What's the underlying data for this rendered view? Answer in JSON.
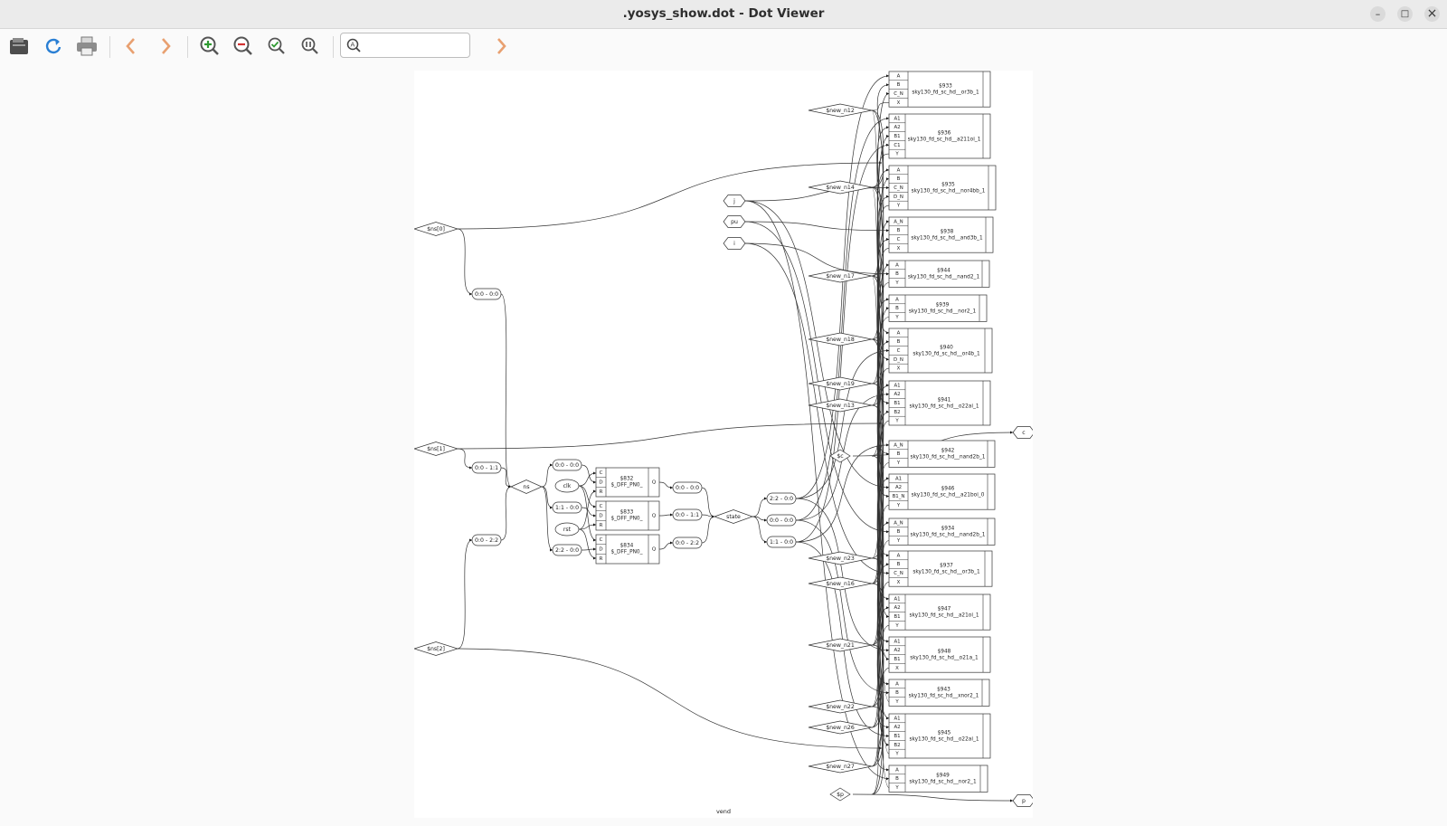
{
  "window": {
    "title": ".yosys_show.dot - Dot Viewer",
    "minimize_glyph": "–",
    "maximize_glyph": "□",
    "close_glyph": "×"
  },
  "toolbar": {
    "buttons": [
      {
        "name": "open-file-button",
        "icon": "folder-icon"
      },
      {
        "name": "reload-button",
        "icon": "reload-icon"
      },
      {
        "name": "print-button",
        "icon": "printer-icon"
      },
      {
        "name": "back-button",
        "icon": "chevron-left-icon"
      },
      {
        "name": "forward-button",
        "icon": "chevron-right-icon"
      },
      {
        "name": "zoom-in-button",
        "icon": "zoom-in-icon"
      },
      {
        "name": "zoom-out-button",
        "icon": "zoom-out-icon"
      },
      {
        "name": "zoom-fit-button",
        "icon": "zoom-fit-icon"
      },
      {
        "name": "zoom-100-button",
        "icon": "zoom-100-icon"
      },
      {
        "name": "find-next-button",
        "icon": "chevron-right-icon"
      }
    ],
    "search": {
      "value": "",
      "placeholder": ""
    }
  },
  "graph": {
    "label": "vend",
    "left_ports": [
      {
        "label": "$ns[0]"
      },
      {
        "label": "$ns[1]"
      },
      {
        "label": "$ns[2]"
      }
    ],
    "split_nodes": [
      {
        "label": "0:0 - 0:0"
      },
      {
        "label": "0:0 - 1:1"
      },
      {
        "label": "0:0 - 2:2"
      }
    ],
    "ns_node": "ns",
    "clk_node": "clk",
    "rst_node": "rst",
    "ns_slices": [
      "0:0 - 0:0",
      "1:1 - 0:0",
      "2:2 - 0:0"
    ],
    "dff_cells": [
      {
        "id": "$832",
        "type": "$_DFF_PN0_",
        "ports": [
          "C",
          "D",
          "R"
        ],
        "out": "Q"
      },
      {
        "id": "$833",
        "type": "$_DFF_PN0_",
        "ports": [
          "C",
          "D",
          "R"
        ],
        "out": "Q"
      },
      {
        "id": "$834",
        "type": "$_DFF_PN0_",
        "ports": [
          "C",
          "D",
          "R"
        ],
        "out": "Q"
      }
    ],
    "q_slices": [
      "0:0 - 0:0",
      "0:0 - 1:1",
      "0:0 - 2:2"
    ],
    "state_node": "state",
    "state_slices": [
      "2:2 - 0:0",
      "0:0 - 0:0",
      "1:1 - 0:0"
    ],
    "inputs": [
      "j",
      "pu",
      "i"
    ],
    "internal_wires": [
      "$new_n12",
      "$new_n14",
      "$new_n17",
      "$new_n18",
      "$new_n19",
      "$new_n13",
      "$c",
      "$new_n23",
      "$new_n16",
      "$new_n21",
      "$new_n22",
      "$new_n26",
      "$new_n27",
      "$p"
    ],
    "outputs": [
      "c",
      "p"
    ],
    "cells": [
      {
        "id": "$933",
        "type": "sky130_fd_sc_hd__or3b_1",
        "ports": [
          "A",
          "B",
          "C_N",
          "X"
        ]
      },
      {
        "id": "$936",
        "type": "sky130_fd_sc_hd__a211oi_1",
        "ports": [
          "A1",
          "A2",
          "B1",
          "C1",
          "Y"
        ]
      },
      {
        "id": "$935",
        "type": "sky130_fd_sc_hd__nor4bb_1",
        "ports": [
          "A",
          "B",
          "C_N",
          "D_N",
          "Y"
        ]
      },
      {
        "id": "$938",
        "type": "sky130_fd_sc_hd__and3b_1",
        "ports": [
          "A_N",
          "B",
          "C",
          "X"
        ]
      },
      {
        "id": "$944",
        "type": "sky130_fd_sc_hd__nand2_1",
        "ports": [
          "A",
          "B",
          "Y"
        ]
      },
      {
        "id": "$939",
        "type": "sky130_fd_sc_hd__nor2_1",
        "ports": [
          "A",
          "B",
          "Y"
        ]
      },
      {
        "id": "$940",
        "type": "sky130_fd_sc_hd__or4b_1",
        "ports": [
          "A",
          "B",
          "C",
          "D_N",
          "X"
        ]
      },
      {
        "id": "$941",
        "type": "sky130_fd_sc_hd__o22ai_1",
        "ports": [
          "A1",
          "A2",
          "B1",
          "B2",
          "Y"
        ]
      },
      {
        "id": "$942",
        "type": "sky130_fd_sc_hd__nand2b_1",
        "ports": [
          "A_N",
          "B",
          "Y"
        ]
      },
      {
        "id": "$946",
        "type": "sky130_fd_sc_hd__a21boi_0",
        "ports": [
          "A1",
          "A2",
          "B1_N",
          "Y"
        ]
      },
      {
        "id": "$934",
        "type": "sky130_fd_sc_hd__nand2b_1",
        "ports": [
          "A_N",
          "B",
          "Y"
        ]
      },
      {
        "id": "$937",
        "type": "sky130_fd_sc_hd__or3b_1",
        "ports": [
          "A",
          "B",
          "C_N",
          "X"
        ]
      },
      {
        "id": "$947",
        "type": "sky130_fd_sc_hd__a21oi_1",
        "ports": [
          "A1",
          "A2",
          "B1",
          "Y"
        ]
      },
      {
        "id": "$948",
        "type": "sky130_fd_sc_hd__o21a_1",
        "ports": [
          "A1",
          "A2",
          "B1",
          "X"
        ]
      },
      {
        "id": "$943",
        "type": "sky130_fd_sc_hd__xnor2_1",
        "ports": [
          "A",
          "B",
          "Y"
        ]
      },
      {
        "id": "$945",
        "type": "sky130_fd_sc_hd__o22ai_1",
        "ports": [
          "A1",
          "A2",
          "B1",
          "B2",
          "Y"
        ]
      },
      {
        "id": "$949",
        "type": "sky130_fd_sc_hd__nor2_1",
        "ports": [
          "A",
          "B",
          "Y"
        ]
      }
    ]
  }
}
